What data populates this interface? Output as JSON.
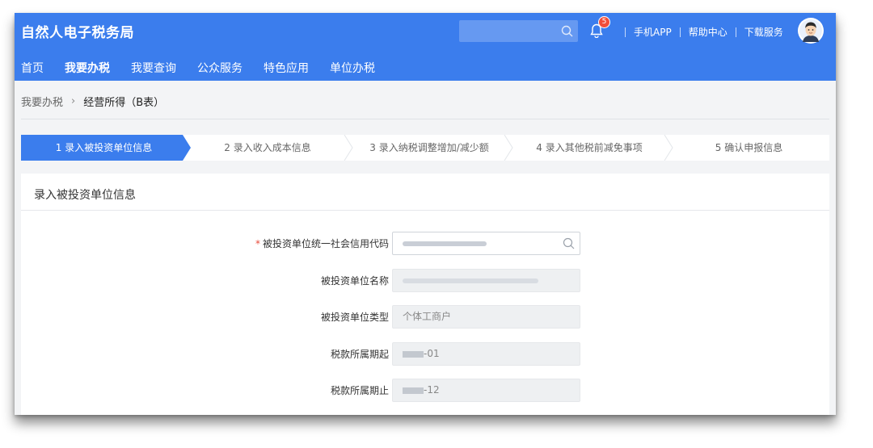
{
  "app": {
    "title": "自然人电子税务局",
    "notification_count": "5",
    "links": [
      "手机APP",
      "帮助中心",
      "下载服务"
    ]
  },
  "nav": {
    "items": [
      "首页",
      "我要办税",
      "我要查询",
      "公众服务",
      "特色应用",
      "单位办税"
    ],
    "active_index": 1
  },
  "breadcrumb": {
    "parent": "我要办税",
    "current": "经营所得（B表）"
  },
  "steps": [
    "1  录入被投资单位信息",
    "2  录入收入成本信息",
    "3  录入纳税调整增加/减少额",
    "4  录入其他税前减免事项",
    "5  确认申报信息"
  ],
  "active_step": 0,
  "panel": {
    "title": "录入被投资单位信息",
    "fields": {
      "credit_code": {
        "label": "被投资单位统一社会信用代码",
        "required_mark": "*"
      },
      "unit_name": {
        "label": "被投资单位名称"
      },
      "unit_type": {
        "label": "被投资单位类型",
        "value": "个体工商户"
      },
      "period_start": {
        "label": "税款所属期起",
        "value_suffix": "-01"
      },
      "period_end": {
        "label": "税款所属期止",
        "value_suffix": "-12"
      }
    }
  },
  "colors": {
    "brand_blue": "#3b7ded",
    "required_red": "#e84b3a",
    "badge_red": "#f04d3a"
  },
  "icons": [
    "search-icon",
    "bell-icon",
    "avatar",
    "chevron-right-icon",
    "input-search-icon"
  ]
}
